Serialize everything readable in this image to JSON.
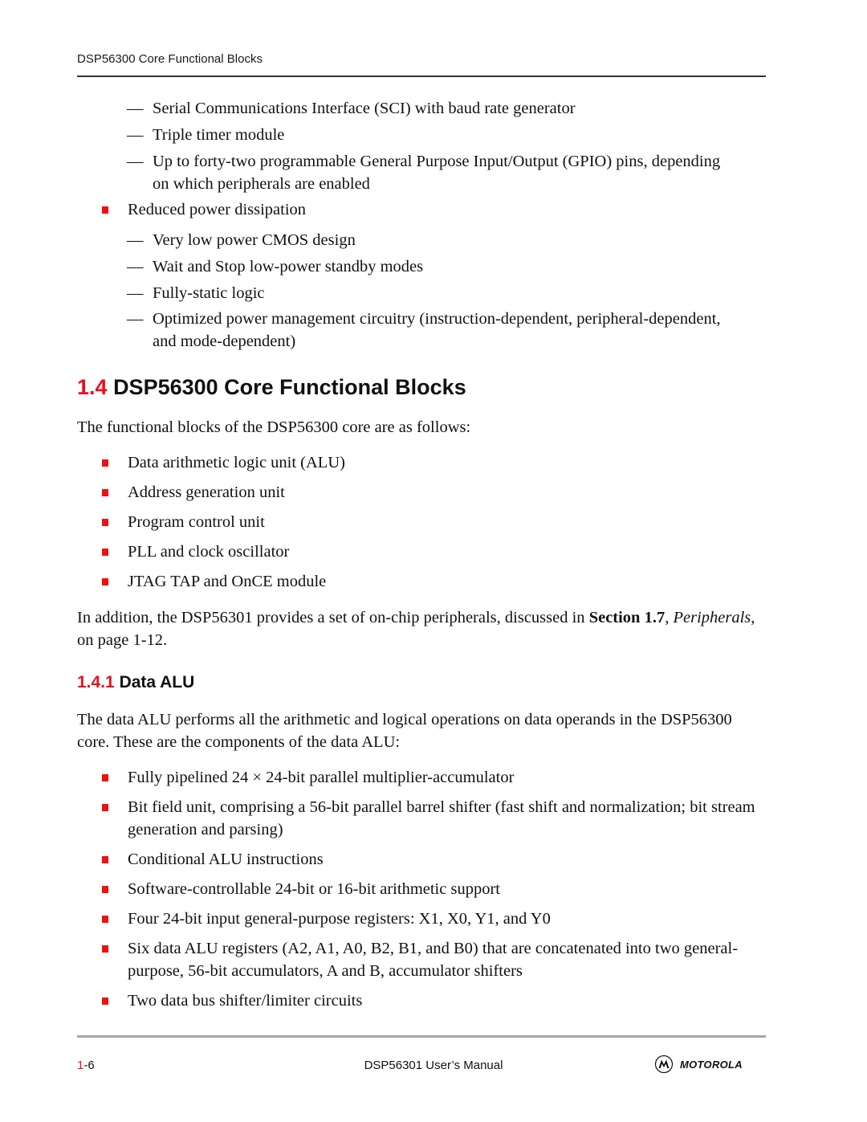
{
  "running_header": "DSP56300 Core Functional Blocks",
  "top_list": {
    "dashes_1": [
      "Serial Communications Interface (SCI) with baud rate generator",
      "Triple timer module",
      "Up to forty-two programmable General Purpose Input/Output (GPIO) pins, depending on which peripherals are enabled"
    ],
    "bullet": "Reduced power dissipation",
    "dashes_2": [
      "Very low power CMOS design",
      "Wait and Stop low-power standby modes",
      "Fully-static logic",
      "Optimized power management circuitry (instruction-dependent, peripheral-dependent, and mode-dependent)"
    ]
  },
  "section": {
    "number": "1.4",
    "title": "DSP56300 Core Functional Blocks",
    "intro": "The functional blocks of the DSP56300 core are as follows:",
    "blocks": [
      "Data arithmetic logic unit (ALU)",
      "Address generation unit",
      "Program control unit",
      "PLL and clock oscillator",
      "JTAG TAP and OnCE module"
    ],
    "addition": {
      "prefix": "In addition, the DSP56301 provides a set of on-chip peripherals, discussed in ",
      "link_bold": "Section 1.7",
      "comma": ",",
      "link_italic": "Peripherals",
      "suffix": ", on page 1-12."
    }
  },
  "subsection": {
    "number": "1.4.1",
    "title": "Data ALU",
    "intro": "The data ALU performs all the arithmetic and logical operations on data operands in the DSP56300 core. These are the components of the data ALU:",
    "components": [
      "Fully pipelined 24 × 24-bit parallel multiplier-accumulator",
      "Bit field unit, comprising a 56-bit parallel barrel shifter (fast shift and normalization; bit stream generation and parsing)",
      "Conditional ALU instructions",
      "Software-controllable 24-bit or 16-bit arithmetic support",
      "Four 24-bit input general-purpose registers: X1, X0, Y1, and Y0",
      "Six data ALU registers (A2, A1, A0, B2, B1, and B0) that are concatenated into two general-purpose, 56-bit accumulators, A and B, accumulator shifters",
      "Two data bus shifter/limiter circuits"
    ]
  },
  "footer": {
    "chapter": "1",
    "page": "-6",
    "manual_title": "DSP56301 User’s Manual",
    "logo_icon": "motorola-batwing-icon",
    "logo_text": "MOTOROLA"
  },
  "colors": {
    "accent_red": "#e8101a",
    "bullet_red": "#ee1111",
    "text": "#111111"
  }
}
